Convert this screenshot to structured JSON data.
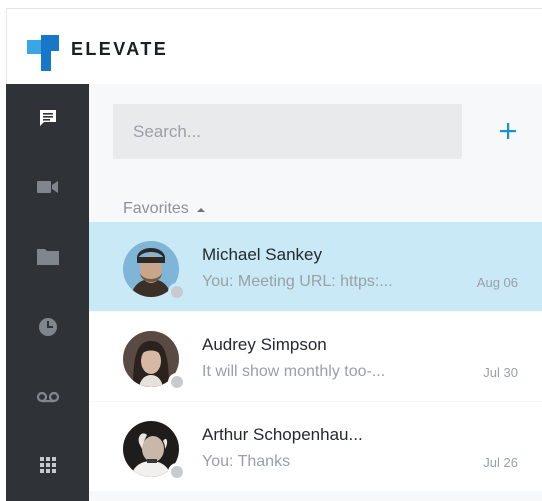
{
  "app": {
    "brand": "ELEVATE",
    "colors": {
      "accent": "#1b8fd6",
      "sidebar": "#2f3338",
      "selected_row": "#c9e9f6",
      "logo_light": "#3aa6e6",
      "logo_dark": "#1877c6"
    }
  },
  "sidebar": {
    "items": [
      {
        "icon": "chat-icon",
        "active": true
      },
      {
        "icon": "video-icon",
        "active": false
      },
      {
        "icon": "folder-icon",
        "active": false
      },
      {
        "icon": "clock-icon",
        "active": false
      },
      {
        "icon": "voicemail-icon",
        "active": false
      },
      {
        "icon": "grid-icon",
        "active": false
      }
    ]
  },
  "search": {
    "placeholder": "Search...",
    "value": ""
  },
  "add_button": {
    "icon": "plus-icon"
  },
  "favorites": {
    "label": "Favorites",
    "expanded": true
  },
  "conversations": [
    {
      "name": "Michael Sankey",
      "preview": "You: Meeting URL: https:...",
      "date": "Aug 06",
      "selected": true,
      "presence": "offline"
    },
    {
      "name": "Audrey Simpson",
      "preview": "It will show monthly too-...",
      "date": "Jul 30",
      "selected": false,
      "presence": "offline"
    },
    {
      "name": "Arthur Schopenhau...",
      "preview": "You: Thanks",
      "date": "Jul 26",
      "selected": false,
      "presence": "offline"
    }
  ]
}
